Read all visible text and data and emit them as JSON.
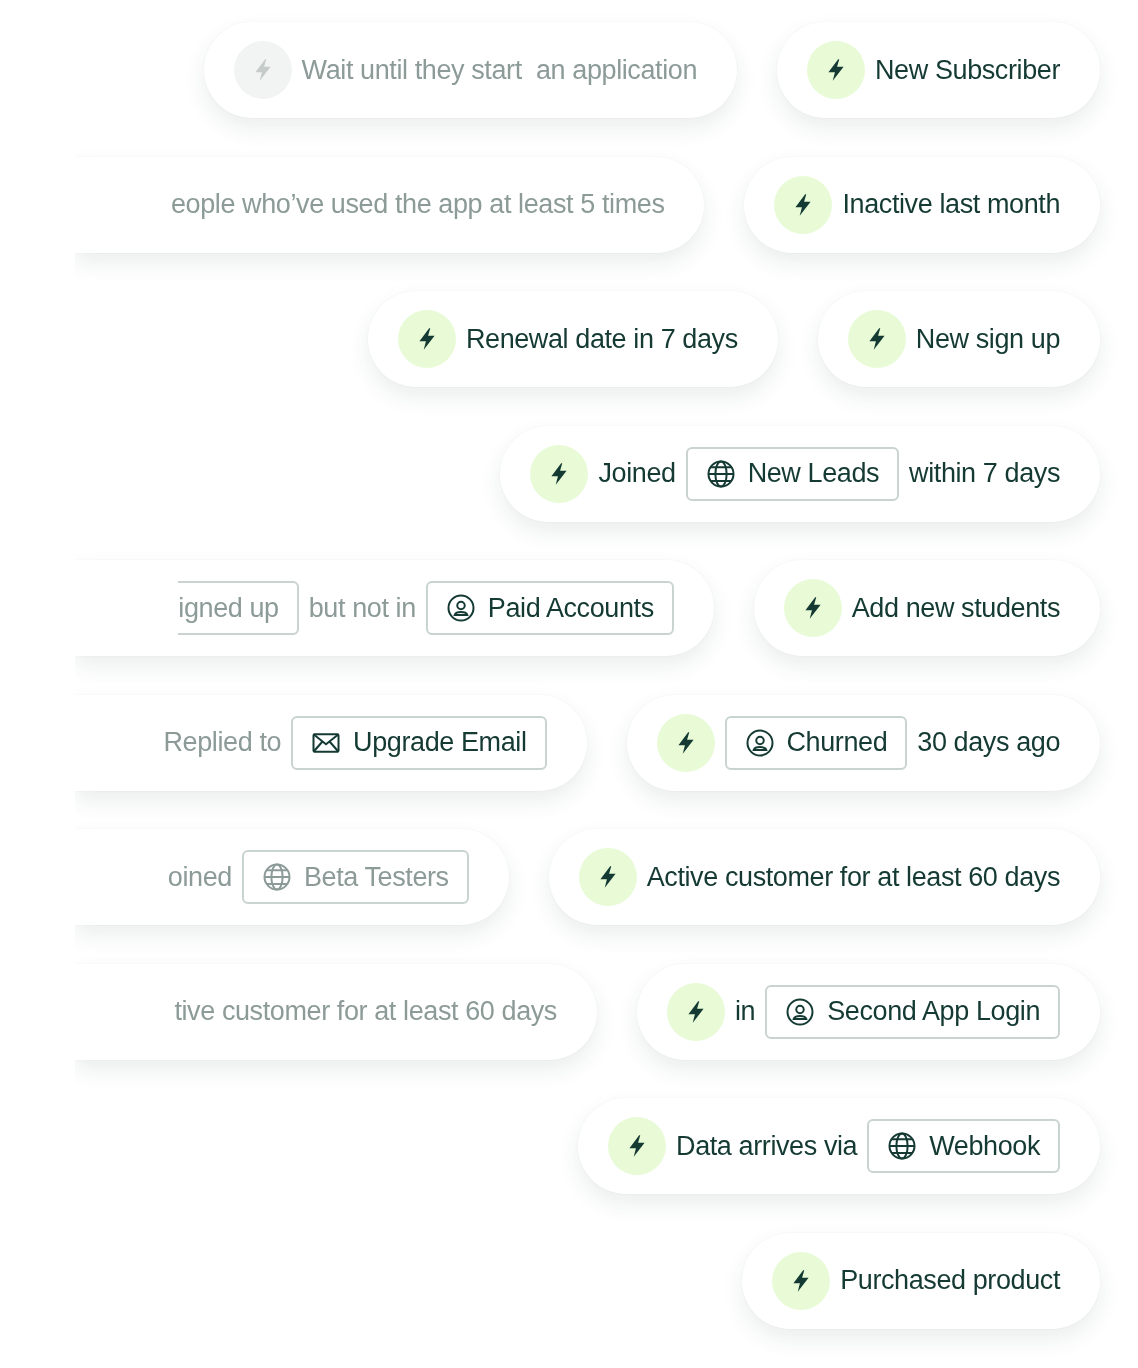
{
  "rows": [
    {
      "pills": [
        {
          "cut": false,
          "items": [
            {
              "kind": "trigger",
              "muted": true
            },
            {
              "kind": "text",
              "text": "Wait until they start  an application",
              "muted": true
            }
          ]
        },
        {
          "cut": false,
          "items": [
            {
              "kind": "trigger",
              "muted": false
            },
            {
              "kind": "text",
              "text": "New Subscriber",
              "muted": false
            }
          ]
        }
      ]
    },
    {
      "pills": [
        {
          "cut": true,
          "items": [
            {
              "kind": "text",
              "text": "eople who’ve used the app at least 5 times",
              "muted": true
            }
          ]
        },
        {
          "cut": false,
          "items": [
            {
              "kind": "trigger",
              "muted": false
            },
            {
              "kind": "text",
              "text": "Inactive last month",
              "muted": false
            }
          ]
        }
      ]
    },
    {
      "pills": [
        {
          "cut": false,
          "items": [
            {
              "kind": "trigger",
              "muted": false
            },
            {
              "kind": "text",
              "text": "Renewal date in 7 days",
              "muted": false
            }
          ]
        },
        {
          "cut": false,
          "items": [
            {
              "kind": "trigger",
              "muted": false
            },
            {
              "kind": "text",
              "text": "New sign up",
              "muted": false
            }
          ]
        }
      ]
    },
    {
      "pills": [
        {
          "cut": false,
          "items": [
            {
              "kind": "trigger",
              "muted": false
            },
            {
              "kind": "text",
              "text": "Joined",
              "muted": false
            },
            {
              "kind": "globe",
              "text": "New Leads",
              "muted": false
            },
            {
              "kind": "text",
              "text": "within 7 days",
              "muted": false
            }
          ]
        }
      ]
    },
    {
      "pills": [
        {
          "cut": true,
          "items": [
            {
              "kind": "fragment",
              "text": "igned up",
              "muted": true
            },
            {
              "kind": "text",
              "text": "but not in",
              "muted": true
            },
            {
              "kind": "person",
              "text": "Paid Accounts",
              "muted": false
            }
          ]
        },
        {
          "cut": false,
          "items": [
            {
              "kind": "trigger",
              "muted": false
            },
            {
              "kind": "text",
              "text": "Add new students",
              "muted": false
            }
          ]
        }
      ]
    },
    {
      "pills": [
        {
          "cut": true,
          "items": [
            {
              "kind": "text",
              "text": "Replied to",
              "muted": true
            },
            {
              "kind": "mail",
              "text": "Upgrade Email",
              "muted": false
            }
          ]
        },
        {
          "cut": false,
          "items": [
            {
              "kind": "trigger",
              "muted": false
            },
            {
              "kind": "person",
              "text": "Churned",
              "muted": false
            },
            {
              "kind": "text",
              "text": "30 days ago",
              "muted": false
            }
          ]
        }
      ]
    },
    {
      "pills": [
        {
          "cut": true,
          "items": [
            {
              "kind": "text",
              "text": "oined",
              "muted": true
            },
            {
              "kind": "globe",
              "text": "Beta Testers",
              "muted": true
            }
          ]
        },
        {
          "cut": false,
          "items": [
            {
              "kind": "trigger",
              "muted": false
            },
            {
              "kind": "text",
              "text": "Active customer for at least 60 days",
              "muted": false
            }
          ]
        }
      ]
    },
    {
      "pills": [
        {
          "cut": true,
          "items": [
            {
              "kind": "text",
              "text": "tive customer for at least 60 days",
              "muted": true
            }
          ]
        },
        {
          "cut": false,
          "items": [
            {
              "kind": "trigger",
              "muted": false
            },
            {
              "kind": "text",
              "text": "in",
              "muted": false
            },
            {
              "kind": "person",
              "text": "Second App Login",
              "muted": false
            }
          ]
        }
      ]
    },
    {
      "pills": [
        {
          "cut": false,
          "items": [
            {
              "kind": "trigger",
              "muted": false
            },
            {
              "kind": "text",
              "text": "Data arrives via",
              "muted": false
            },
            {
              "kind": "globe",
              "text": "Webhook",
              "muted": false
            }
          ]
        }
      ]
    },
    {
      "pills": [
        {
          "cut": false,
          "items": [
            {
              "kind": "trigger",
              "muted": false
            },
            {
              "kind": "text",
              "text": "Purchased product",
              "muted": false
            }
          ]
        }
      ]
    }
  ]
}
